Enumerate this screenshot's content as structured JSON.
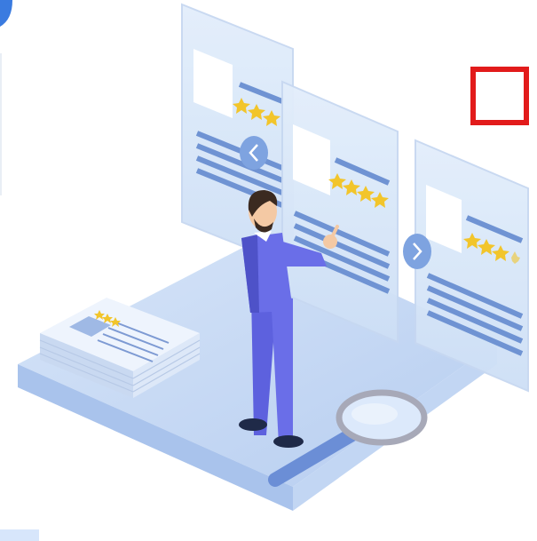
{
  "colors": {
    "background": "#ffffff",
    "panel_fill": "#dbe8f8",
    "panel_stroke": "#b9cfee",
    "line_blue": "#6f93d3",
    "line_dark": "#4f74bf",
    "star": "#f2c52b",
    "platform_top": "#bcd3f3",
    "platform_side": "#9fbbe6",
    "person_suit": "#6a6ee8",
    "person_suit_dark": "#4e52c8",
    "person_skin": "#f4c9a4",
    "person_hair": "#3b2a20",
    "nav_button": "#7ea3e0",
    "annotation_box": "#e21b1b",
    "magnifier_glass": "#d9e7fa",
    "magnifier_handle": "#6b8ed6"
  },
  "panels": [
    {
      "name": "review-card-left",
      "stars_filled": 3,
      "stars_total": 3
    },
    {
      "name": "review-card-center",
      "stars_filled": 4,
      "stars_total": 4
    },
    {
      "name": "review-card-right",
      "stars_filled": 3.5,
      "stars_total": 4
    }
  ],
  "icons": {
    "prev": "chevron-left-icon",
    "next": "chevron-right-icon",
    "search": "magnifier-icon"
  }
}
